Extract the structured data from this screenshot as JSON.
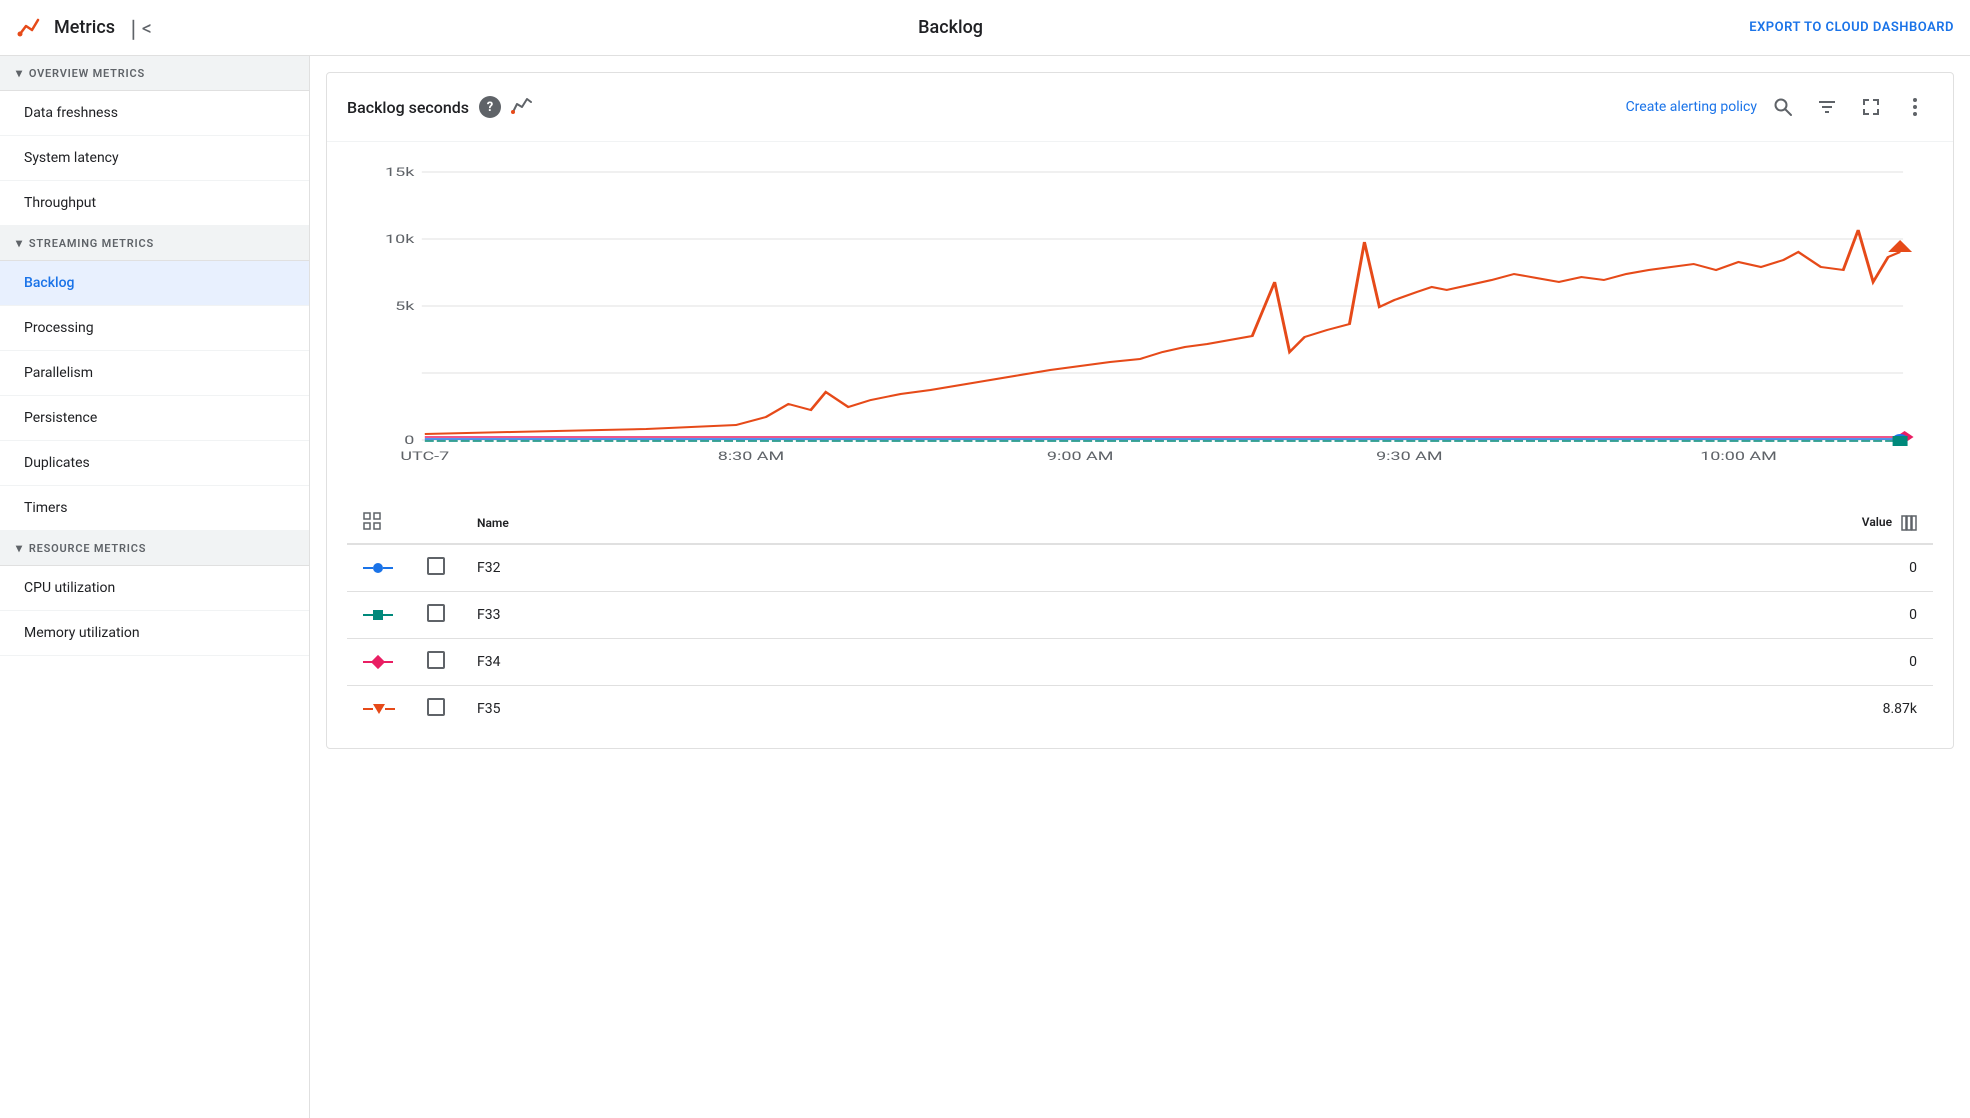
{
  "app": {
    "title": "Metrics",
    "logo_icon": "metrics-icon",
    "collapse_icon": "collapse-icon",
    "page_title": "Backlog",
    "export_label": "EXPORT TO CLOUD DASHBOARD"
  },
  "sidebar": {
    "sections": [
      {
        "id": "overview",
        "label": "OVERVIEW METRICS",
        "items": [
          {
            "id": "data-freshness",
            "label": "Data freshness",
            "active": false
          },
          {
            "id": "system-latency",
            "label": "System latency",
            "active": false
          },
          {
            "id": "throughput",
            "label": "Throughput",
            "active": false
          }
        ]
      },
      {
        "id": "streaming",
        "label": "STREAMING METRICS",
        "items": [
          {
            "id": "backlog",
            "label": "Backlog",
            "active": true
          },
          {
            "id": "processing",
            "label": "Processing",
            "active": false
          },
          {
            "id": "parallelism",
            "label": "Parallelism",
            "active": false
          },
          {
            "id": "persistence",
            "label": "Persistence",
            "active": false
          },
          {
            "id": "duplicates",
            "label": "Duplicates",
            "active": false
          },
          {
            "id": "timers",
            "label": "Timers",
            "active": false
          }
        ]
      },
      {
        "id": "resource",
        "label": "RESOURCE METRICS",
        "items": [
          {
            "id": "cpu-utilization",
            "label": "CPU utilization",
            "active": false
          },
          {
            "id": "memory-utilization",
            "label": "Memory utilization",
            "active": false
          }
        ]
      }
    ]
  },
  "chart": {
    "title": "Backlog seconds",
    "help_icon": "help-icon",
    "metrics_icon": "metrics-graph-icon",
    "create_alerting_label": "Create alerting policy",
    "search_icon": "search-icon",
    "filter_icon": "filter-icon",
    "fullscreen_icon": "fullscreen-icon",
    "more_icon": "more-vert-icon",
    "y_axis_labels": [
      "15k",
      "10k",
      "5k",
      "0"
    ],
    "x_axis_labels": [
      "UTC-7",
      "8:30 AM",
      "9:00 AM",
      "9:30 AM",
      "10:00 AM"
    ],
    "legend": {
      "name_header": "Name",
      "value_header": "Value",
      "rows": [
        {
          "id": "F32",
          "name": "F32",
          "value": "0",
          "color": "#1a73e8",
          "shape": "circle"
        },
        {
          "id": "F33",
          "name": "F33",
          "value": "0",
          "color": "#00897b",
          "shape": "square"
        },
        {
          "id": "F34",
          "name": "F34",
          "value": "0",
          "color": "#e91e63",
          "shape": "diamond"
        },
        {
          "id": "F35",
          "name": "F35",
          "value": "8.87k",
          "color": "#e64a19",
          "shape": "triangle-down"
        }
      ]
    }
  }
}
